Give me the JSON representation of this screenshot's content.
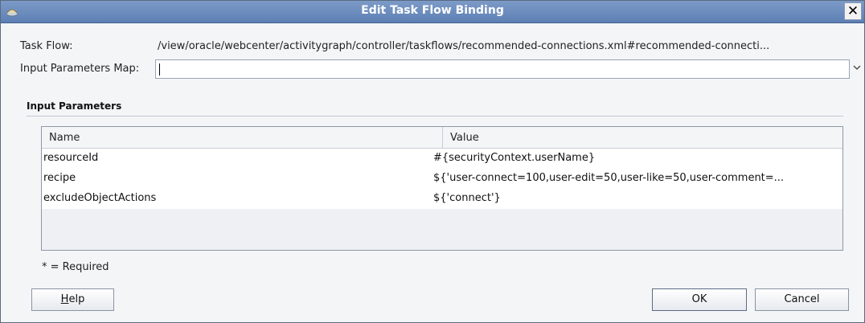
{
  "window": {
    "title": "Edit Task Flow Binding",
    "close_label": "✕"
  },
  "task_flow": {
    "label": "Task Flow:",
    "value": "/view/oracle/webcenter/activitygraph/controller/taskflows/recommended-connections.xml#recommended-connecti..."
  },
  "input_map": {
    "label": "Input Parameters Map:",
    "value": "",
    "dropdown_icon": "chevron-down-icon"
  },
  "input_parameters": {
    "section_title": "Input Parameters",
    "columns": [
      "Name",
      "Value"
    ],
    "rows": [
      {
        "name": "resourceId",
        "value": "#{securityContext.userName}"
      },
      {
        "name": "recipe",
        "value": "${'user-connect=100,user-edit=50,user-like=50,user-comment=..."
      },
      {
        "name": "excludeObjectActions",
        "value": "${'connect'}"
      }
    ]
  },
  "required_note": "* = Required",
  "buttons": {
    "help": "Help",
    "ok": "OK",
    "cancel": "Cancel"
  }
}
